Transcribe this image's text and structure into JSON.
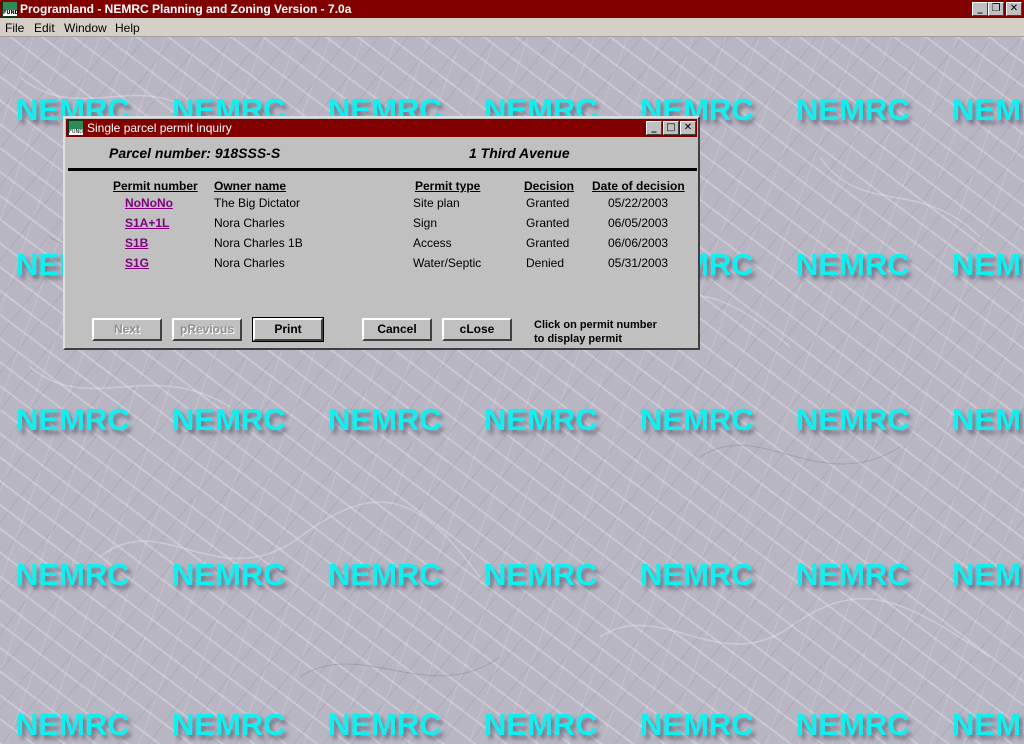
{
  "app": {
    "title": "Programland - NEMRC Planning and Zoning Version - 7.0a",
    "window_controls": {
      "minimize": "_",
      "restore": "❐",
      "close": "✕"
    }
  },
  "menu": [
    "File",
    "Edit",
    "Window",
    "Help"
  ],
  "watermark_text": "NEMRC",
  "dialog": {
    "title": "Single parcel permit inquiry",
    "controls": {
      "minimize": "_",
      "maximize": "□",
      "close": "✕"
    },
    "parcel_label": "Parcel number: 918SSS-S",
    "address": "1 Third Avenue",
    "columns": [
      "Permit number",
      "Owner name",
      "Permit type",
      "Decision",
      "Date of decision"
    ],
    "rows": [
      {
        "permit": "NoNoNo",
        "owner": "The Big Dictator",
        "type": "Site plan",
        "decision": "Granted",
        "date": "05/22/2003"
      },
      {
        "permit": "S1A+1L",
        "owner": "Nora Charles",
        "type": "Sign",
        "decision": "Granted",
        "date": "06/05/2003"
      },
      {
        "permit": "S1B",
        "owner": "Nora Charles 1B",
        "type": "Access",
        "decision": "Granted",
        "date": "06/06/2003"
      },
      {
        "permit": "S1G",
        "owner": "Nora Charles",
        "type": "Water/Septic",
        "decision": "Denied",
        "date": "05/31/2003"
      }
    ],
    "buttons": {
      "next": "Next",
      "previous": "pRevious",
      "print": "Print",
      "cancel": "Cancel",
      "close": "cLose"
    },
    "hint_line1": "Click on permit number",
    "hint_line2": "to display permit"
  },
  "colors": {
    "titlebar": "#800000",
    "watermark": "#10f0f0",
    "link": "#800080"
  }
}
